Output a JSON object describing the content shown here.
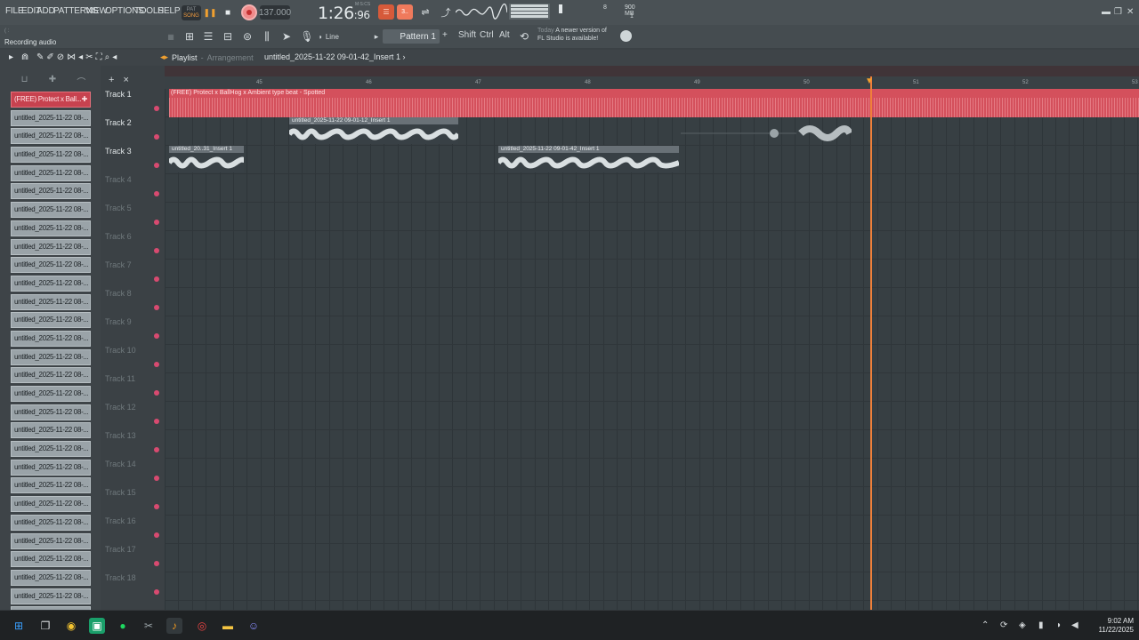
{
  "menu": [
    "FILE",
    "EDIT",
    "ADD",
    "PATTERNS",
    "VIEW",
    "OPTIONS",
    "TOOLS",
    "HELP"
  ],
  "transport": {
    "song_label": "SONG",
    "pat_label": "PAT",
    "tempo": "137.000",
    "time_main": "1:26",
    "time_small": ":96",
    "time_unit": "M:S:CS"
  },
  "cpu": {
    "value": "8",
    "memory": "900 MB",
    "poly": "1"
  },
  "hint": {
    "small": "( :",
    "text": "Recording audio"
  },
  "toolbar2": {
    "snap": "Line",
    "pattern": "Pattern 1",
    "shift": "Shift",
    "ctrl": "Ctrl",
    "alt": "Alt",
    "update_today": "Today",
    "update_msg1": "A newer version of",
    "update_msg2": "FL Studio is available!"
  },
  "playlist": {
    "title": "Playlist",
    "sep": "-",
    "mode": "Arrangement",
    "breadcrumb": "untitled_2025-11-22 09-01-42_Insert 1 ›"
  },
  "ruler": [
    "45",
    "46",
    "47",
    "48",
    "49",
    "50",
    "51",
    "52",
    "53"
  ],
  "clips": [
    "(FREE) Protect x Ball...",
    "untitled_2025-11-22 08-...",
    "untitled_2025-11-22 08-...",
    "untitled_2025-11-22 08-...",
    "untitled_2025-11-22 08-...",
    "untitled_2025-11-22 08-...",
    "untitled_2025-11-22 08-...",
    "untitled_2025-11-22 08-...",
    "untitled_2025-11-22 08-...",
    "untitled_2025-11-22 08-...",
    "untitled_2025-11-22 08-...",
    "untitled_2025-11-22 08-...",
    "untitled_2025-11-22 08-...",
    "untitled_2025-11-22 08-...",
    "untitled_2025-11-22 08-...",
    "untitled_2025-11-22 08-...",
    "untitled_2025-11-22 08-...",
    "untitled_2025-11-22 08-...",
    "untitled_2025-11-22 08-...",
    "untitled_2025-11-22 08-...",
    "untitled_2025-11-22 08-...",
    "untitled_2025-11-22 08-...",
    "untitled_2025-11-22 08-...",
    "untitled_2025-11-22 08-...",
    "untitled_2025-11-22 08-...",
    "untitled_2025-11-22 08-...",
    "untitled_2025-11-22 08-...",
    "untitled_2025-11-22 08-...",
    "untitled_2025-11-22 08-..."
  ],
  "tracks": [
    "Track 1",
    "Track 2",
    "Track 3",
    "Track 4",
    "Track 5",
    "Track 6",
    "Track 7",
    "Track 8",
    "Track 9",
    "Track 10",
    "Track 11",
    "Track 12",
    "Track 13",
    "Track 14",
    "Track 15",
    "Track 16",
    "Track 17",
    "Track 18"
  ],
  "audio_clips": {
    "red": "(FREE) Protect x BallHog x Ambient type beat - Spotted",
    "c2": "untitled_2025-11-22 09-01-12_Insert 1",
    "c3a": "untitled_20..31_Insert 1",
    "c3b": "untitled_2025-11-22 09-01-42_Insert 1"
  },
  "clock": {
    "time": "9:02 AM",
    "date": "11/22/2025"
  },
  "colors": {
    "accent": "#f0a030",
    "selected": "#c7424f",
    "track1": "#d4505c",
    "playhead": "#f0803a"
  }
}
